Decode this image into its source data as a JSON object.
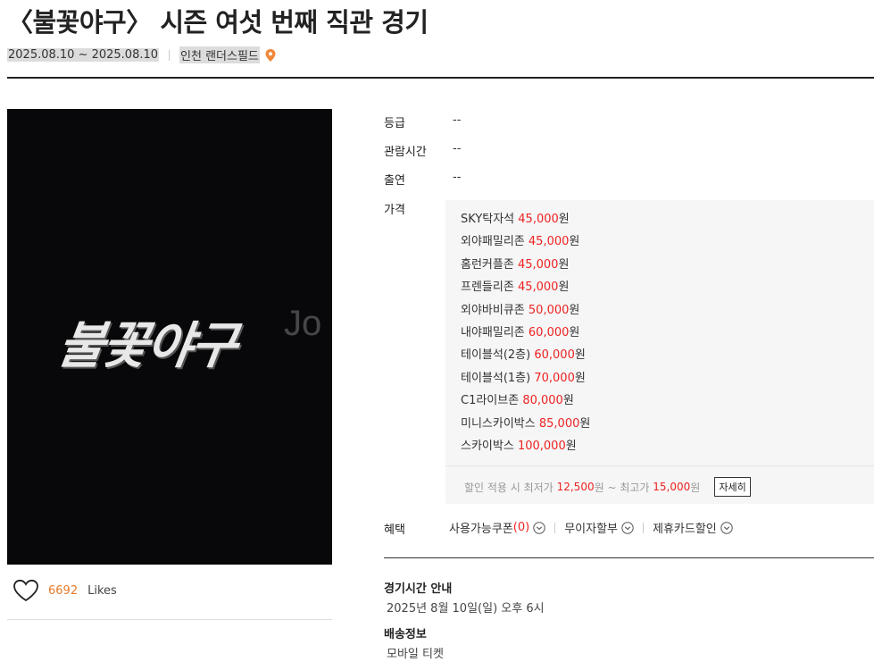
{
  "event": {
    "title": "〈불꽃야구〉 시즌 여섯 번째 직관 경기",
    "date_range": "2025.08.10 ~ 2025.08.10",
    "venue": "인천 랜더스필드"
  },
  "poster": {
    "logo_text": "불꽃야구",
    "watermark": "Jo"
  },
  "likes": {
    "count": "6692",
    "label": "Likes"
  },
  "info": {
    "grade_label": "등급",
    "grade_value": "--",
    "runtime_label": "관람시간",
    "runtime_value": "--",
    "cast_label": "출연",
    "cast_value": "--",
    "price_label": "가격",
    "prices": [
      {
        "zone": "SKY탁자석",
        "amount": "45,000",
        "unit": "원"
      },
      {
        "zone": "외야패밀리존",
        "amount": "45,000",
        "unit": "원"
      },
      {
        "zone": "홈런커플존",
        "amount": "45,000",
        "unit": "원"
      },
      {
        "zone": "프렌들리존",
        "amount": "45,000",
        "unit": "원"
      },
      {
        "zone": "외야바비큐존",
        "amount": "50,000",
        "unit": "원"
      },
      {
        "zone": "내야패밀리존",
        "amount": "60,000",
        "unit": "원"
      },
      {
        "zone": "테이블석(2층)",
        "amount": "60,000",
        "unit": "원"
      },
      {
        "zone": "테이블석(1층)",
        "amount": "70,000",
        "unit": "원"
      },
      {
        "zone": "C1라이브존",
        "amount": "80,000",
        "unit": "원"
      },
      {
        "zone": "미니스카이박스",
        "amount": "85,000",
        "unit": "원"
      },
      {
        "zone": "스카이박스",
        "amount": "100,000",
        "unit": "원"
      }
    ],
    "discount_prefix": "할인 적용 시 최저가",
    "discount_min": "12,500",
    "discount_mid": "원 ~ 최고가",
    "discount_max": "15,000",
    "discount_suffix": "원",
    "detail_button": "자세히",
    "benefit_label": "혜택",
    "benefit_coupon": "사용가능쿠폰",
    "benefit_coupon_count": "(0)",
    "benefit_installment": "무이자할부",
    "benefit_card": "제휴카드할인"
  },
  "schedule": {
    "title": "경기시간 안내",
    "text": "2025년 8월 10일(일) 오후 6시"
  },
  "delivery": {
    "title": "배송정보",
    "text": "모바일 티켓"
  },
  "colors": {
    "accent": "#e87a2c",
    "price": "#e22222",
    "poster_bg": "#08080a"
  }
}
